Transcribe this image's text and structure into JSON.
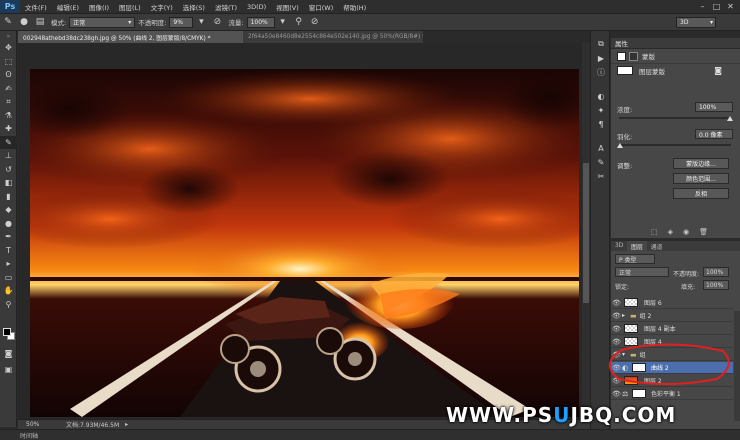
{
  "app": {
    "logo": "Ps"
  },
  "menu": [
    "文件(F)",
    "编辑(E)",
    "图像(I)",
    "图层(L)",
    "文字(Y)",
    "选择(S)",
    "滤镜(T)",
    "3D(D)",
    "视图(V)",
    "窗口(W)",
    "帮助(H)"
  ],
  "options": {
    "mode_label": "模式:",
    "mode_value": "正常",
    "opacity_label": "不透明度:",
    "opacity_value": "9%",
    "flow_label": "流量:",
    "flow_value": "100%",
    "workspace": "3D"
  },
  "tabs": [
    {
      "label": "002948athebd38dc238gh.jpg @ 50% (曲线 2, 图层蒙版/8/CMYK) *"
    },
    {
      "label": "2f64a50e8460d8e2554c864e502e140.jpg @ 50%(RGB/8#) *"
    }
  ],
  "status": {
    "zoom": "50%",
    "doc": "文档:7.93M/46.5M"
  },
  "timeline": {
    "label": "时间轴"
  },
  "properties": {
    "title": "属性",
    "mode": "蒙版",
    "mask_label": "图层蒙版",
    "density_label": "浓度:",
    "density_value": "100%",
    "feather_label": "羽化:",
    "feather_value": "0.0 像素",
    "adjust_label": "调整:",
    "btn_edge": "蒙版边缘...",
    "btn_color_range": "颜色范围...",
    "btn_invert": "反相"
  },
  "layers": {
    "tabs": [
      "3D",
      "图层",
      "通道"
    ],
    "filter": "P 类型",
    "blend": "正常",
    "opacity_label": "不透明度:",
    "opacity_value": "100%",
    "lock_label": "锁定:",
    "fill_label": "填充:",
    "fill_value": "100%",
    "items": [
      {
        "name": "图层 6",
        "thumb": "checker",
        "group": false
      },
      {
        "name": "组 2",
        "thumb": "none",
        "group": true
      },
      {
        "name": "图层 4 副本",
        "thumb": "checker",
        "group": false
      },
      {
        "name": "图层 4",
        "thumb": "checker",
        "group": false
      },
      {
        "name": "组",
        "thumb": "none",
        "group": true
      },
      {
        "name": "曲线 2",
        "thumb": "white",
        "group": false,
        "selected": true
      },
      {
        "name": "图层 2",
        "thumb": "fire",
        "group": false
      },
      {
        "name": "色彩平衡 1",
        "thumb": "white",
        "group": false
      }
    ]
  },
  "watermark": {
    "a": "WWW.PS",
    "b": "U",
    "c": "JBQ",
    "d": ".COM"
  },
  "colors": {
    "accent": "#1da1ff",
    "selection": "#4b6eaf",
    "circle": "#e02020"
  }
}
